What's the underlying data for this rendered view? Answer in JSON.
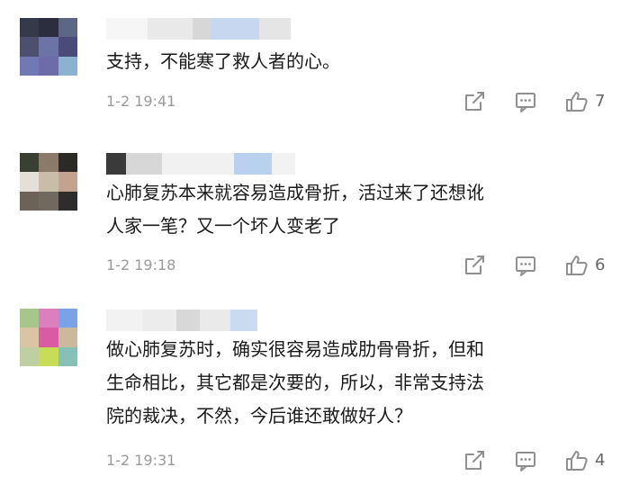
{
  "colors": {
    "text": "#1a1a1a",
    "meta": "#9a9a9a",
    "icon": "#8f8f8f"
  },
  "comments": [
    {
      "avatar_colors": [
        "#35394a",
        "#2c2e40",
        "#5d6685",
        "#4d4f6f",
        "#6c73a7",
        "#4a4b78",
        "#7079b3",
        "#6d6ba8",
        "#8db1d0"
      ],
      "username_blur_colors": [
        "#f6f6f6",
        "#e9e9e9",
        "#d7d7d7",
        "#c7d7ef",
        "#e5e5e5"
      ],
      "text": "支持，不能寒了救人者的心。",
      "time": "1-2 19:41",
      "like_count": "7",
      "icons": [
        "share-icon",
        "reply-icon",
        "like-icon"
      ]
    },
    {
      "avatar_colors": [
        "#3a4031",
        "#8b7a6a",
        "#2b2a27",
        "#e4dfd8",
        "#c9bca8",
        "#c3a38f",
        "#6d6258",
        "#6f6960",
        "#2e2d2c"
      ],
      "username_blur_colors": [
        "#3a3a3a",
        "#d7d7d7",
        "#f1f1f1",
        "#b9d0ef",
        "#f2f2f2"
      ],
      "text": "心肺复苏本来就容易造成骨折，活过来了还想讹\n人家一笔？又一个坏人变老了",
      "time": "1-2 19:18",
      "like_count": "6",
      "icons": [
        "share-icon",
        "reply-icon",
        "like-icon"
      ]
    },
    {
      "avatar_colors": [
        "#a7c68c",
        "#db7fbe",
        "#7aa2e7",
        "#d9c4a3",
        "#d85ba4",
        "#cbb99f",
        "#bfcfa3",
        "#c7dd57",
        "#87c0b7"
      ],
      "username_blur_colors": [
        "#f2f2f2",
        "#ececec",
        "#d8d8d8",
        "#eaeaea",
        "#c9daf1"
      ],
      "text": "做心肺复苏时，确实很容易造成肋骨骨折，但和\n生命相比，其它都是次要的，所以，非常支持法\n院的裁决，不然，今后谁还敢做好人？",
      "time": "1-2 19:31",
      "like_count": "4",
      "icons": [
        "share-icon",
        "reply-icon",
        "like-icon"
      ]
    }
  ]
}
